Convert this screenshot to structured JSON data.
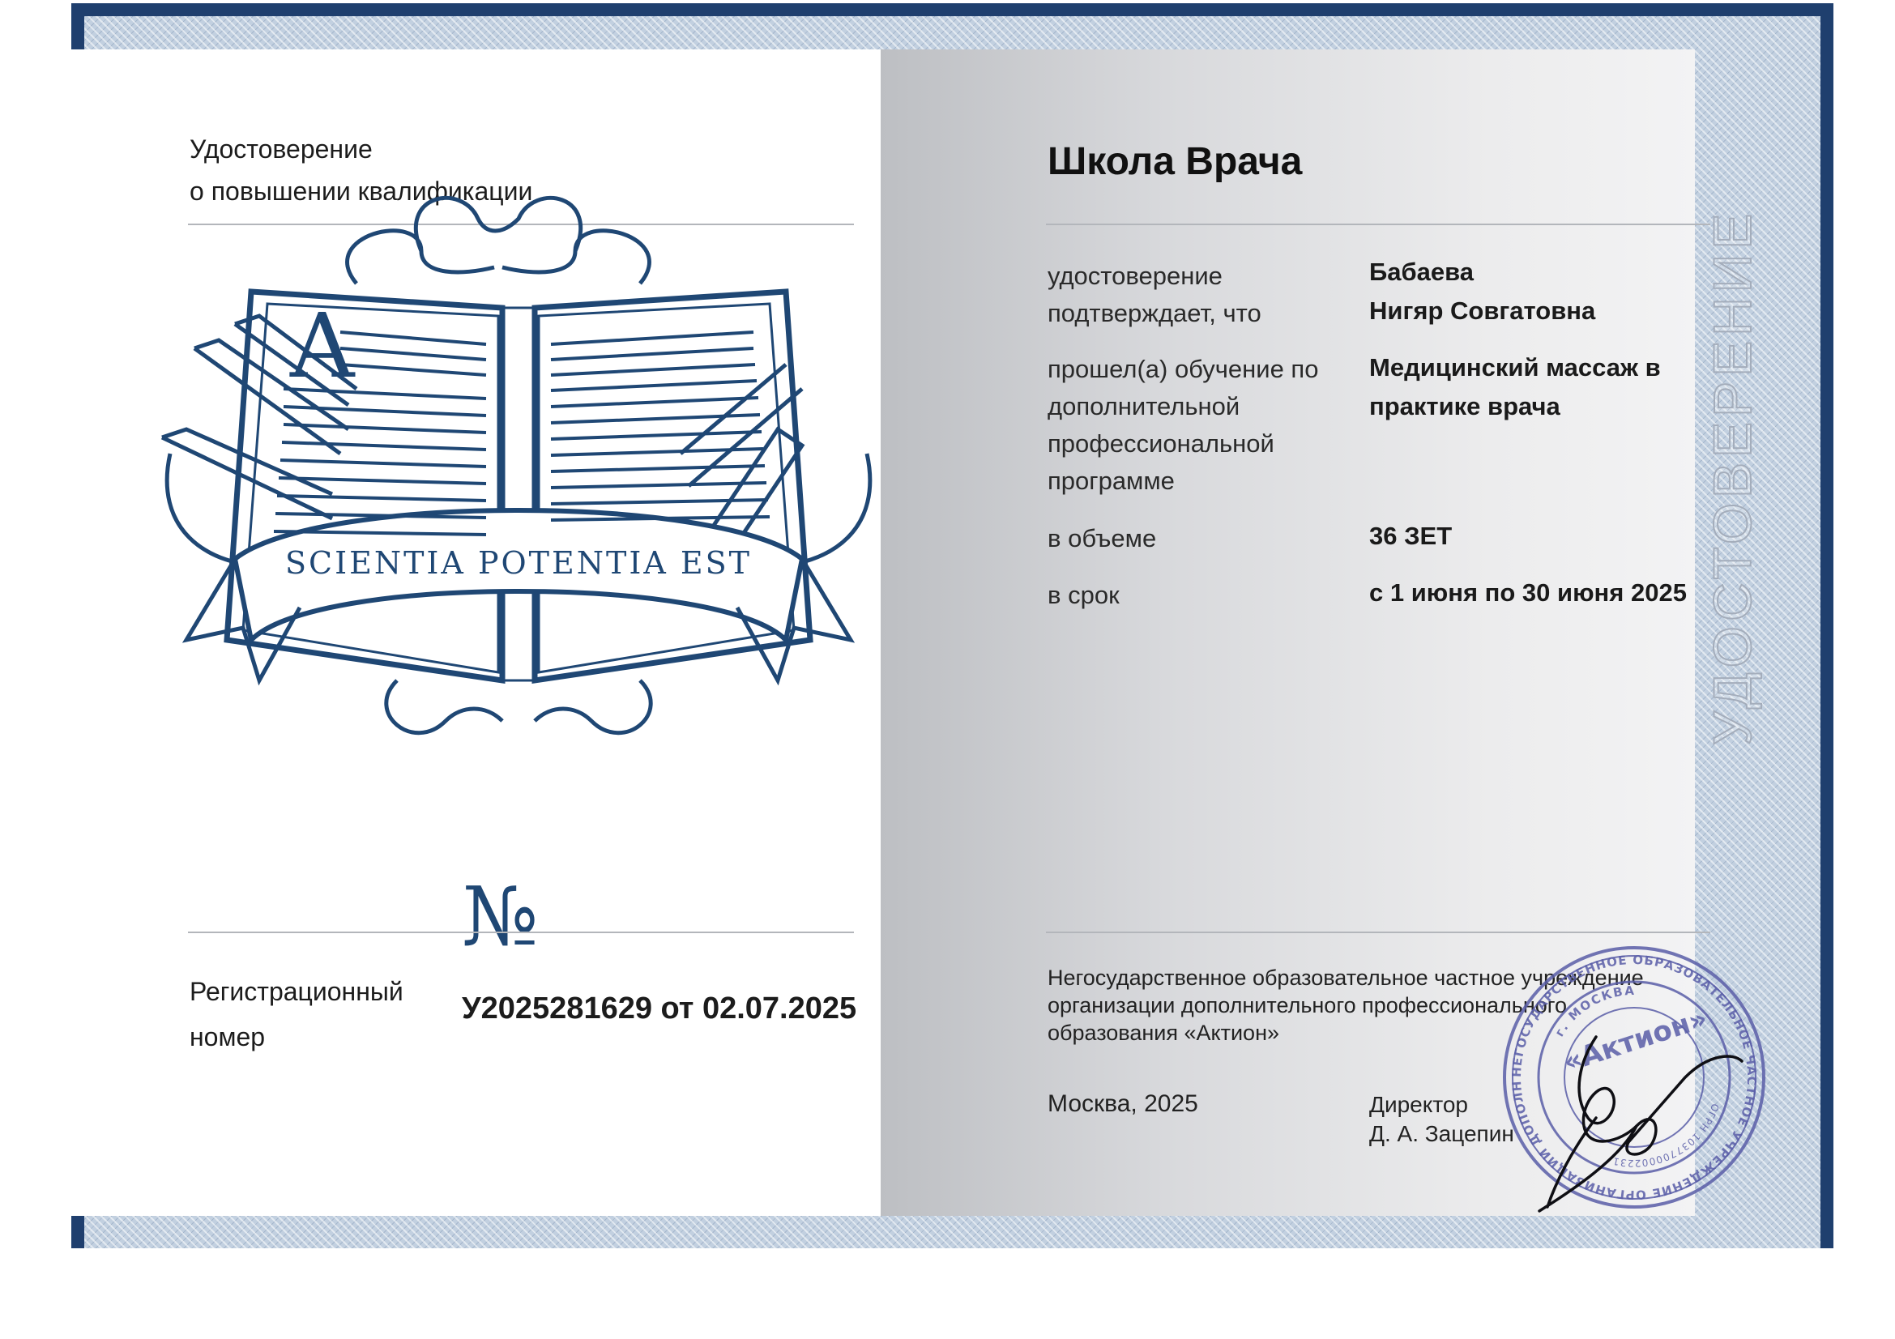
{
  "left_page": {
    "title_line1": "Удостоверение",
    "title_line2": "о повышении квалификации",
    "emblem": {
      "letter": "A",
      "motto": "SCIENTIA POTENTIA EST",
      "icon": "open-book-emblem"
    },
    "numero_sign": "№",
    "reg_label_line1": "Регистрационный",
    "reg_label_line2": "номер",
    "reg_number": "У2025281629 от 02.07.2025"
  },
  "right_page": {
    "school_name": "Школа Врача",
    "vertical_title": "УДОСТОВЕРЕНИЕ",
    "rows": [
      {
        "label": [
          "удостоверение",
          "подтверждает, что"
        ],
        "value": [
          "Бабаева",
          "Нигяр Совгатовна"
        ]
      },
      {
        "label": [
          "прошел(а) обучение по",
          "дополнительной",
          "профессиональной",
          "программе"
        ],
        "value": [
          "Медицинский массаж в",
          "практике врача"
        ]
      },
      {
        "label": [
          "в объеме"
        ],
        "value": [
          "36 ЗЕТ"
        ]
      },
      {
        "label": [
          "в срок"
        ],
        "value": [
          "с 1 июня по 30 июня 2025"
        ]
      }
    ],
    "org_line1": "Негосударственное образовательное частное учреждение",
    "org_line2": "организации дополнительного профессионального",
    "org_line3": "образования «Актион»",
    "city_year": "Москва, 2025",
    "director_title": "Директор",
    "director_name": "Д. А. Зацепин",
    "stamp": {
      "center_text": "«Актион»",
      "ring_text": "НЕГОСУДАРСТВЕННОЕ ОБРАЗОВАТЕЛЬНОЕ ЧАСТНОЕ УЧРЕЖДЕНИЕ ОРГАНИЗАЦИИ ДОПОЛНИТЕЛЬНОГО ПРОФЕССИОНАЛЬНОГО ОБРАЗОВАНИЯ",
      "city_text": "г. МОСКВА",
      "ogrn_text": "ОГРН 1037700002231",
      "color": "#5a5ea8"
    }
  },
  "colors": {
    "cover": "#1f3f6e",
    "emblem": "#1f4774",
    "stamp": "#5a5ea8"
  }
}
